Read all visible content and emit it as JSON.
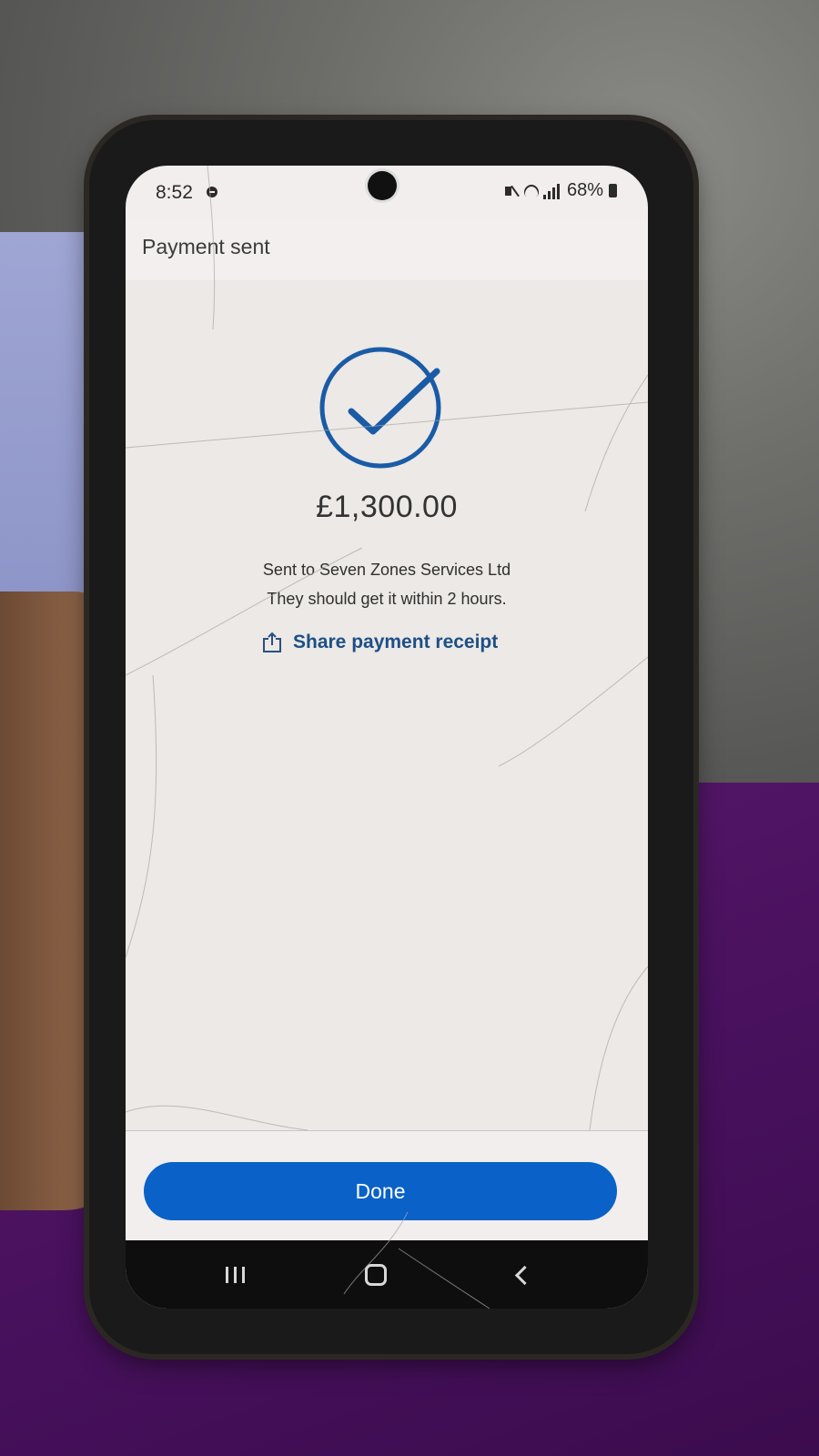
{
  "status_bar": {
    "time": "8:52",
    "battery": "68%"
  },
  "header": {
    "title": "Payment sent"
  },
  "confirmation": {
    "amount": "£1,300.00",
    "recipient_line": "Sent to Seven Zones Services Ltd",
    "eta_line": "They should get it within 2 hours.",
    "share_label": "Share payment receipt"
  },
  "footer": {
    "done_label": "Done"
  },
  "colors": {
    "accent": "#0a61c8",
    "link": "#1d4f86",
    "check": "#1a5ba6"
  }
}
